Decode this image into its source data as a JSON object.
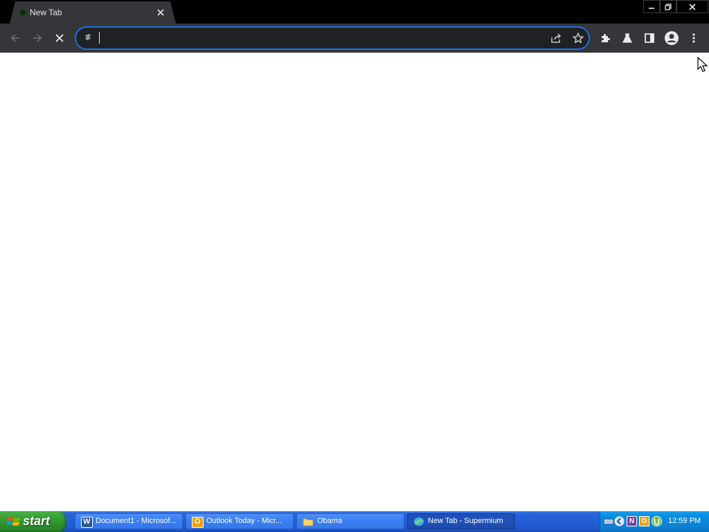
{
  "browser": {
    "tab": {
      "title": "New Tab"
    },
    "omnibox": {
      "value": "",
      "placeholder": ""
    }
  },
  "taskbar": {
    "start_label": "start",
    "buttons": [
      {
        "label": "Document1 - Microsof...",
        "icon": "word-icon",
        "color": "#2b579a"
      },
      {
        "label": "Outlook Today - Micr...",
        "icon": "outlook-icon",
        "color": "#e8a317"
      },
      {
        "label": "Obama",
        "icon": "folder-icon",
        "color": "#f5d36b"
      },
      {
        "label": "New Tab - Supermium",
        "icon": "supermium-icon",
        "color": "#3fb4e8",
        "active": true
      }
    ],
    "tray": {
      "icons": [
        "keyboard-icon",
        "back-arrow-icon",
        "onenote-icon",
        "outlook-icon",
        "utorrent-icon"
      ],
      "clock": "12:59 PM"
    }
  },
  "colors": {
    "accent": "#1a73e8",
    "chrome_dark": "#35363a",
    "titlebar": "#000000",
    "taskbar_blue": "#245ed6",
    "start_green": "#3ca63c"
  }
}
